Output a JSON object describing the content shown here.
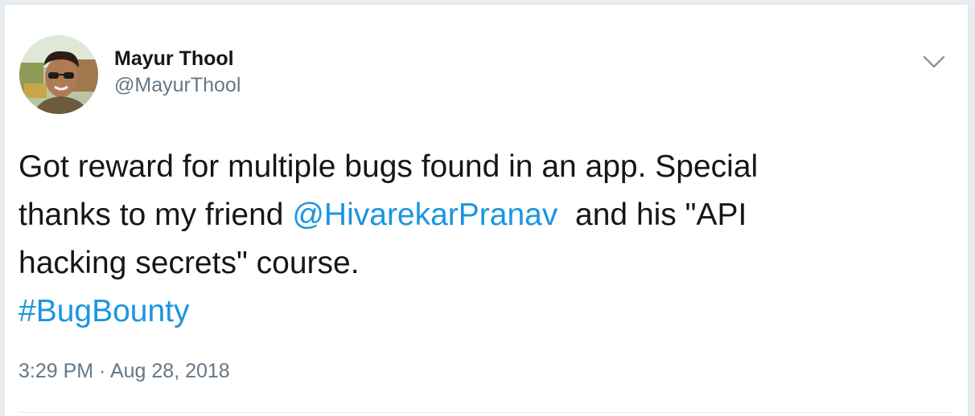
{
  "tweet": {
    "author": {
      "display_name": "Mayur Thool",
      "handle": "@MayurThool"
    },
    "icons": {
      "menu": "chevron-down-icon",
      "avatar": "profile-photo"
    },
    "text": {
      "line1": "Got reward for multiple bugs found in an app. Special",
      "line2_prefix": "thanks to my friend ",
      "mention": "@HivarekarPranav",
      "line2_suffix": "  and his \"API",
      "line3": "hacking secrets\" course.",
      "hashtag": "#BugBounty"
    },
    "timestamp": {
      "time": "3:29 PM",
      "separator": " · ",
      "date": "Aug 28, 2018"
    },
    "colors": {
      "link": "#1b95e0",
      "text": "#14171a",
      "secondary": "#657786"
    }
  }
}
